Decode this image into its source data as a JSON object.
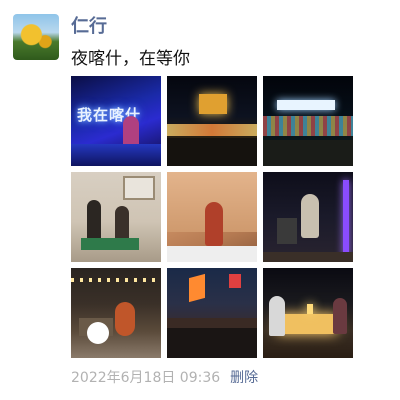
{
  "post": {
    "username": "仁行",
    "text": "夜喀什，在等你",
    "photos": [
      {
        "name": "photo-1",
        "neon_text": "我在喀什"
      },
      {
        "name": "photo-2"
      },
      {
        "name": "photo-3"
      },
      {
        "name": "photo-4"
      },
      {
        "name": "photo-5"
      },
      {
        "name": "photo-6"
      },
      {
        "name": "photo-7"
      },
      {
        "name": "photo-8"
      },
      {
        "name": "photo-9"
      }
    ],
    "timestamp": "2022年6月18日 09:36",
    "delete_label": "删除"
  },
  "colors": {
    "username": "#576b95",
    "delete": "#576b95",
    "timestamp": "#b2b2b2",
    "text": "#111111"
  }
}
